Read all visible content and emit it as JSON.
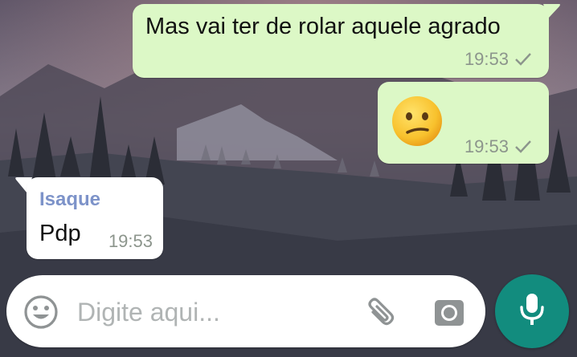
{
  "messages": [
    {
      "direction": "outgoing",
      "text": "Mas vai ter de rolar aquele agrado",
      "time": "19:53",
      "status": "sent-check-icon"
    },
    {
      "direction": "outgoing",
      "emoji": "😕",
      "emoji_name": "confused-face-emoji",
      "time": "19:53",
      "status": "sent-check-icon"
    },
    {
      "direction": "incoming",
      "sender": "Isaque",
      "text": "Pdp",
      "time": "19:53"
    }
  ],
  "composer": {
    "placeholder": "Digite aqui...",
    "value": "",
    "emoji_icon": "emoji-icon",
    "attach_icon": "paperclip-icon",
    "camera_icon": "camera-icon"
  },
  "mic_button": {
    "icon": "microphone-icon"
  },
  "colors": {
    "outgoing_bubble": "#dcf8c6",
    "incoming_bubble": "#ffffff",
    "sender_name": "#7d93c9",
    "mic_button": "#128c7e"
  }
}
